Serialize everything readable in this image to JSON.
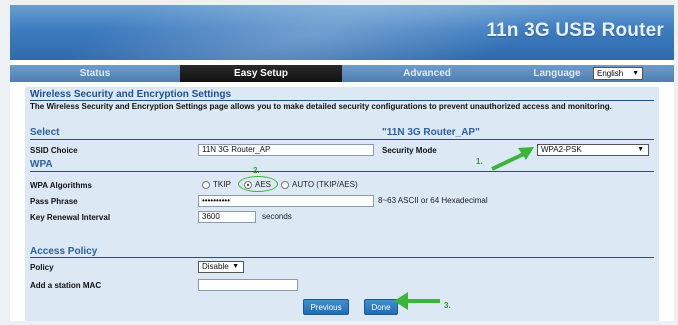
{
  "header": {
    "title": "11n 3G USB Router"
  },
  "nav": {
    "tabs": [
      {
        "label": "Status"
      },
      {
        "label": "Easy Setup"
      },
      {
        "label": "Advanced"
      },
      {
        "label": "Language"
      }
    ],
    "language_value": "English"
  },
  "page": {
    "title": "Wireless Security and Encryption Settings",
    "description": "The Wireless Security and Encryption Settings page allows you to make detailed security configurations to prevent unauthorized access and monitoring."
  },
  "select_section": {
    "title": "Select",
    "ssid_header": "\"11N 3G Router_AP\"",
    "ssid_label": "SSID Choice",
    "ssid_value": "11N 3G Router_AP",
    "security_mode_label": "Security Mode",
    "security_mode_value": "WPA2-PSK"
  },
  "wpa_section": {
    "title": "WPA",
    "algorithms_label": "WPA Algorithms",
    "algorithms": [
      {
        "label": "TKIP",
        "checked": false
      },
      {
        "label": "AES",
        "checked": true
      },
      {
        "label": "AUTO (TKIP/AES)",
        "checked": false
      }
    ],
    "pass_phrase_label": "Pass Phrase",
    "pass_phrase_value": "••••••••••",
    "pass_phrase_hint": "8~63 ASCII or 64 Hexadecimal",
    "key_renewal_label": "Key Renewal Interval",
    "key_renewal_value": "3600",
    "key_renewal_unit": "seconds"
  },
  "access_policy": {
    "title": "Access Policy",
    "policy_label": "Policy",
    "policy_value": "Disable",
    "station_mac_label": "Add a station MAC",
    "station_mac_value": ""
  },
  "buttons": {
    "previous": "Previous",
    "done": "Done"
  },
  "annotations": {
    "step1": "1.",
    "step2": "2.",
    "step3": "3."
  },
  "colors": {
    "accent_blue": "#2b5fa6",
    "arrow_green": "#3cb339",
    "active_tab": "#1a1a1a"
  },
  "icons": {
    "dropdown": "chevron-down-icon",
    "arrow": "green-arrow-icon"
  }
}
